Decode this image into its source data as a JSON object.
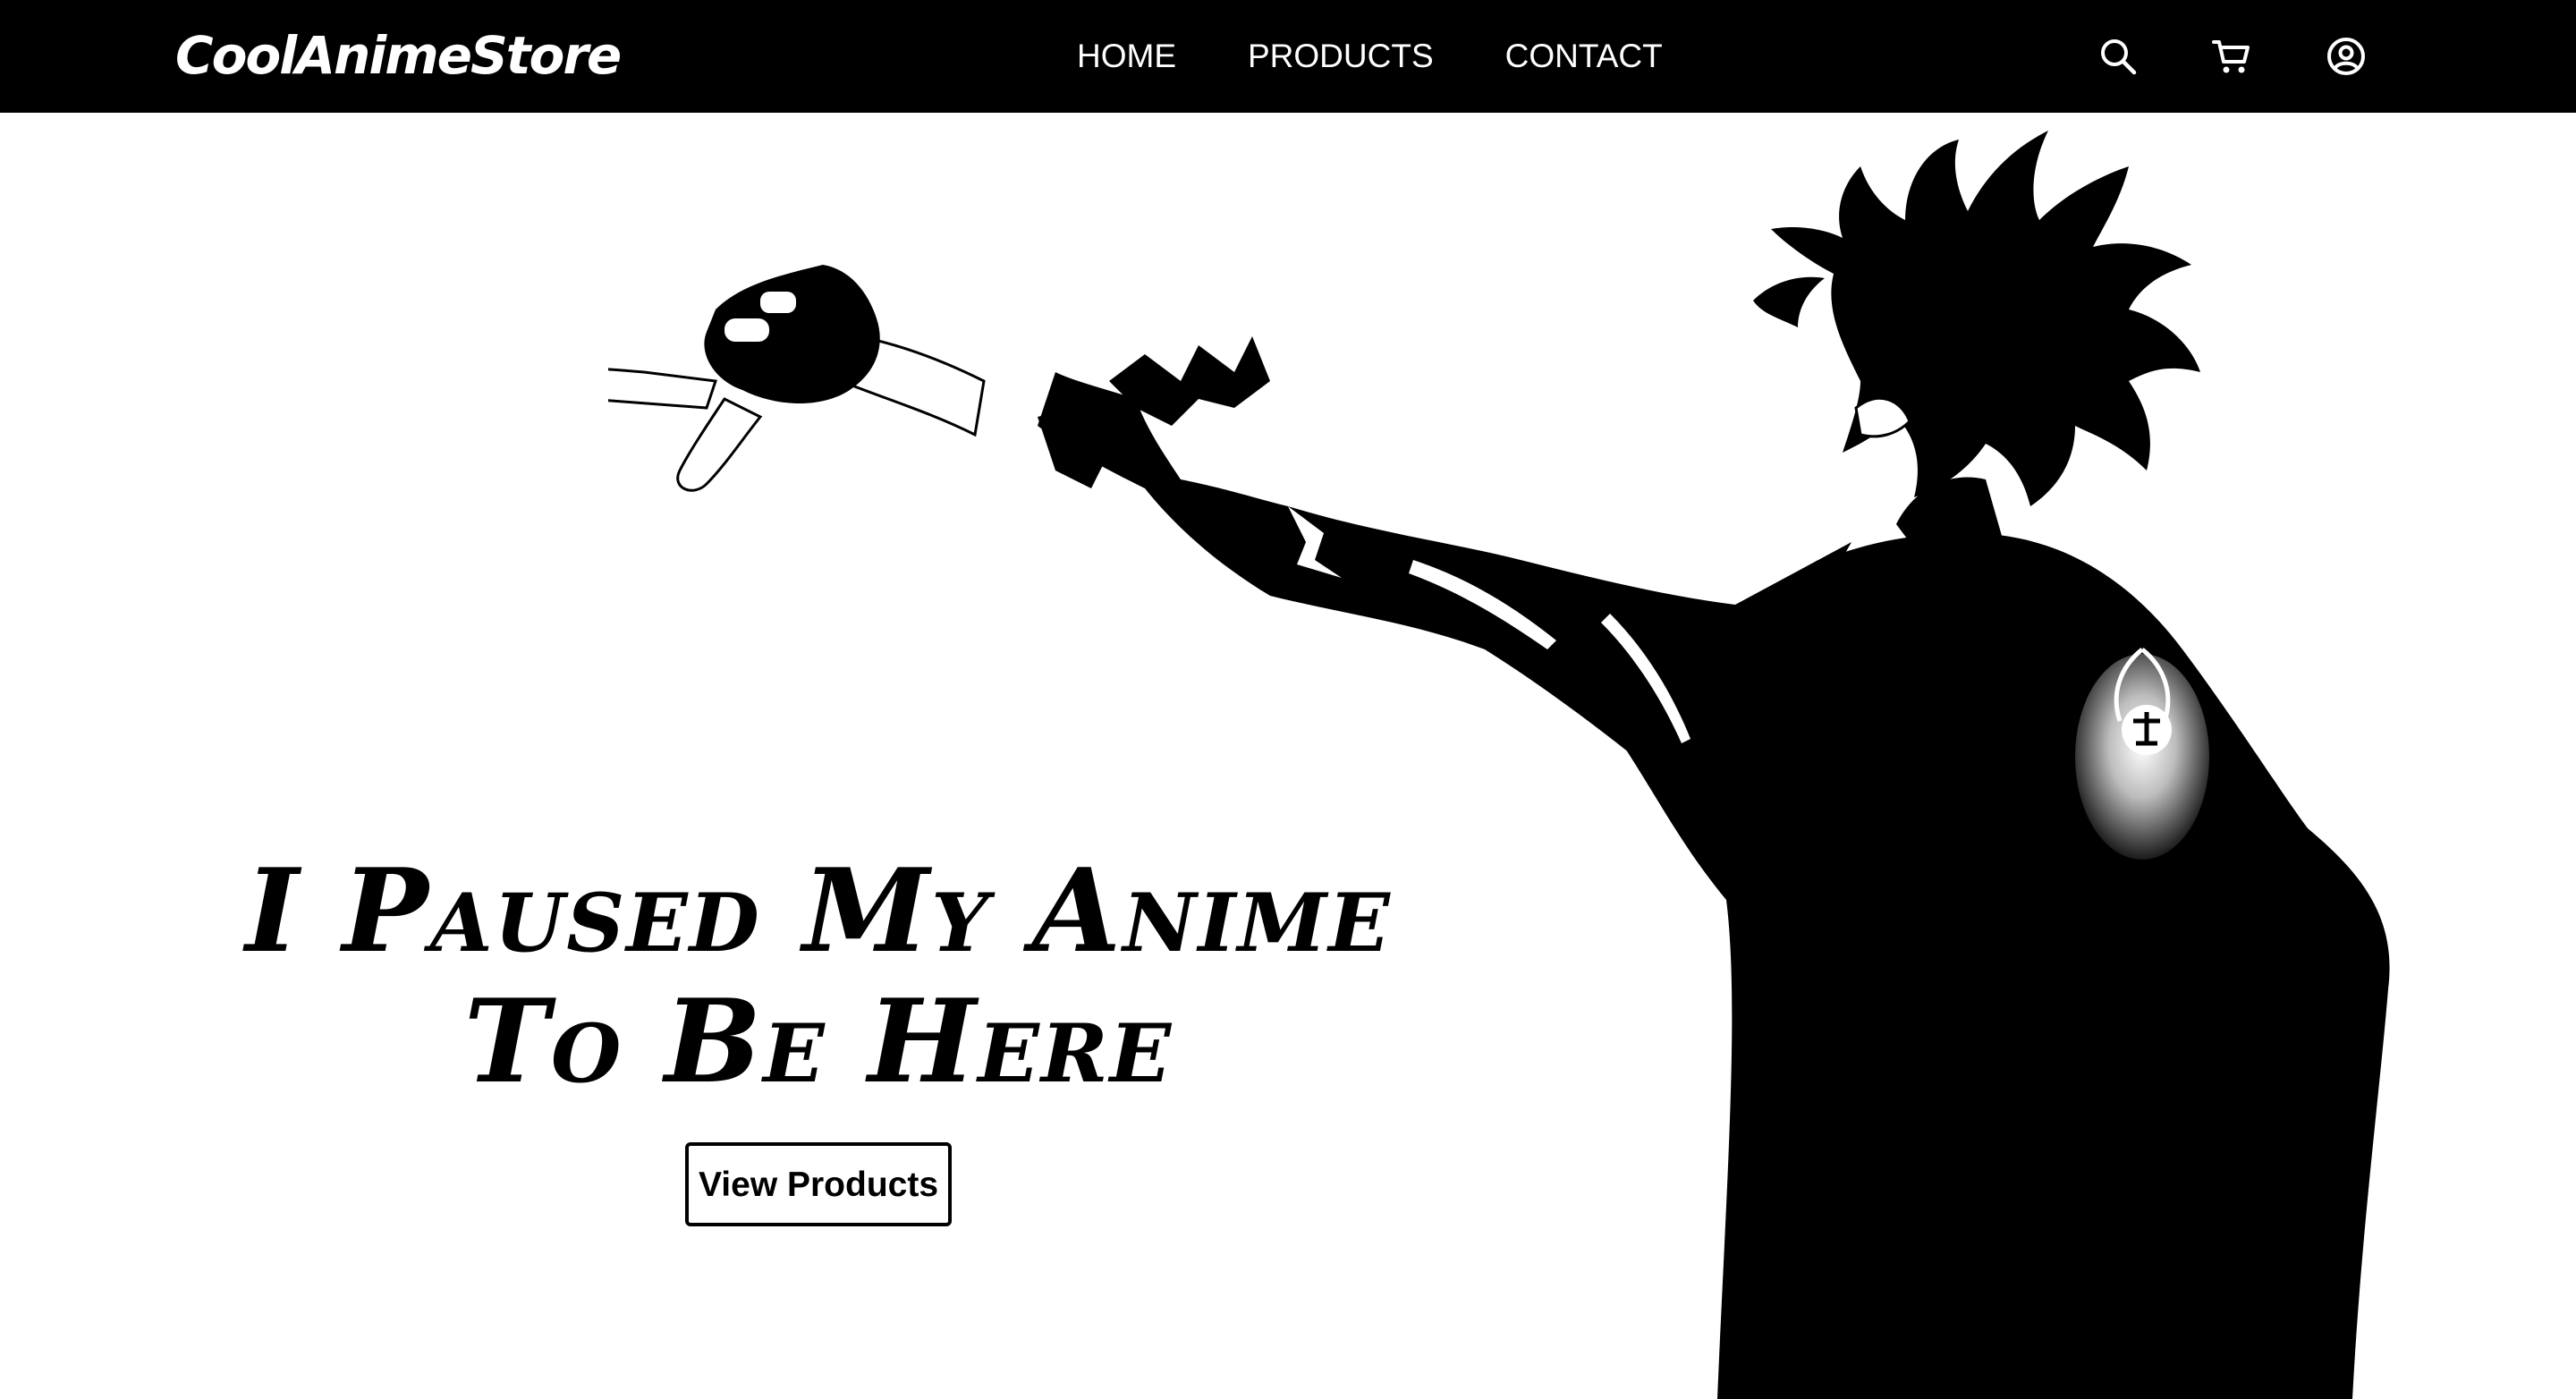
{
  "brand": {
    "name": "CoolAnimeStore"
  },
  "nav": {
    "links": [
      {
        "label": "HOME"
      },
      {
        "label": "PRODUCTS"
      },
      {
        "label": "CONTACT"
      }
    ],
    "icons": [
      "search-icon",
      "cart-icon",
      "account-icon"
    ]
  },
  "hero": {
    "headline_line1": "I Paused My Anime",
    "headline_line2": "To Be Here",
    "cta_label": "View Products",
    "image": "black-and-white anime character silhouette pointing"
  },
  "colors": {
    "navbar_bg": "#000000",
    "nav_text": "#ffffff",
    "page_bg": "#ffffff",
    "text": "#000000"
  }
}
